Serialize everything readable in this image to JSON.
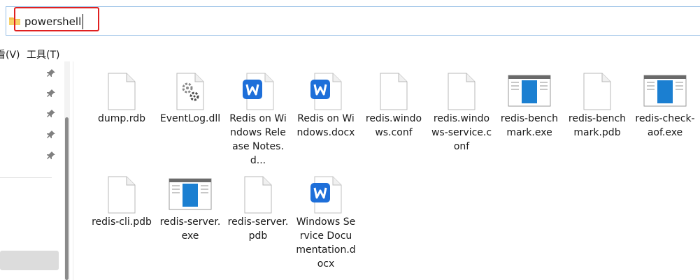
{
  "address": {
    "value": "powershell"
  },
  "menu": [
    {
      "label": "看(V)"
    },
    {
      "label": "工具(T)"
    }
  ],
  "files": [
    {
      "name": "dump.rdb",
      "icon": "generic-file-icon"
    },
    {
      "name": "EventLog.dll",
      "icon": "dll-gear-file-icon"
    },
    {
      "name": "Redis on Windows Release Notes.d...",
      "icon": "wps-writer-doc-icon"
    },
    {
      "name": "Redis on Windows.docx",
      "icon": "wps-writer-doc-icon"
    },
    {
      "name": "redis.windows.conf",
      "icon": "generic-file-icon"
    },
    {
      "name": "redis.windows-service.conf",
      "icon": "generic-file-icon"
    },
    {
      "name": "redis-benchmark.exe",
      "icon": "exe-window-icon"
    },
    {
      "name": "redis-benchmark.pdb",
      "icon": "generic-file-icon"
    },
    {
      "name": "redis-check-aof.exe",
      "icon": "exe-window-icon"
    },
    {
      "name": "redis-cli.pdb",
      "icon": "generic-file-icon"
    },
    {
      "name": "redis-server.exe",
      "icon": "exe-window-icon"
    },
    {
      "name": "redis-server.pdb",
      "icon": "generic-file-icon"
    },
    {
      "name": "Windows Service Documentation.docx",
      "icon": "wps-writer-doc-icon"
    }
  ],
  "colors": {
    "highlight": "#e02020",
    "wps_blue": "#1e6fd9",
    "exe_blue": "#1b7fd1"
  }
}
